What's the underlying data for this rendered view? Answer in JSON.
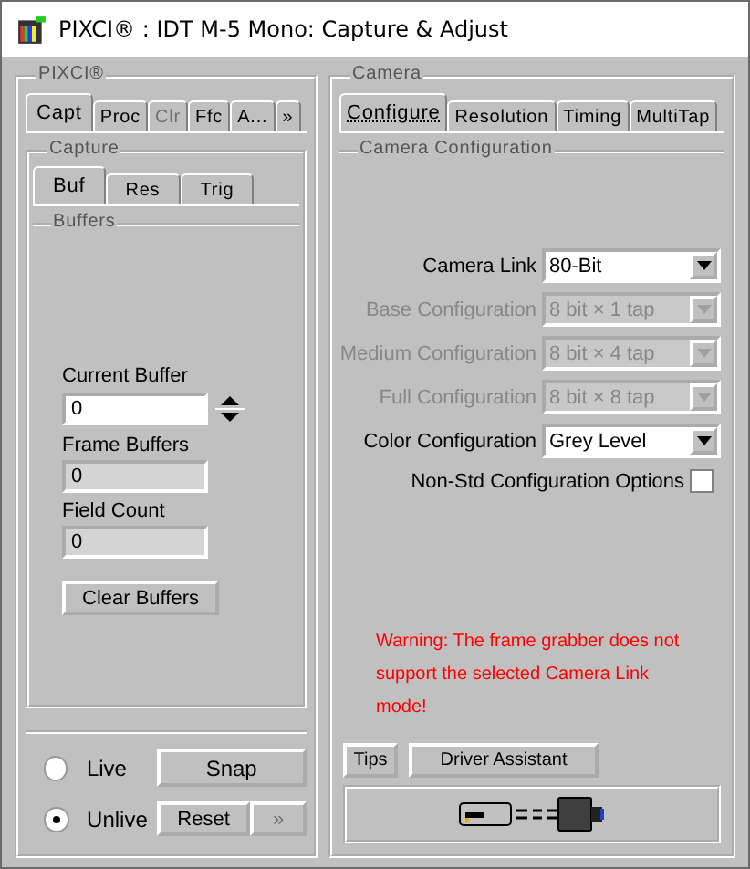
{
  "window": {
    "title": "PIXCI® : IDT M-5 Mono: Capture & Adjust"
  },
  "left": {
    "legend": "PIXCI®",
    "tabs": [
      {
        "label": "Capt",
        "selected": true,
        "disabled": false
      },
      {
        "label": "Proc",
        "selected": false,
        "disabled": false
      },
      {
        "label": "Clr",
        "selected": false,
        "disabled": true
      },
      {
        "label": "Ffc",
        "selected": false,
        "disabled": false
      },
      {
        "label": "A...",
        "selected": false,
        "disabled": false
      },
      {
        "label": "»",
        "selected": false,
        "disabled": false
      }
    ],
    "capture": {
      "legend": "Capture",
      "tabs": [
        {
          "label": "Buf",
          "selected": true
        },
        {
          "label": "Res",
          "selected": false
        },
        {
          "label": "Trig",
          "selected": false
        }
      ],
      "buffers": {
        "legend": "Buffers",
        "fields": [
          {
            "label": "Current Buffer",
            "value": "0",
            "kind": "spin"
          },
          {
            "label": "Frame Buffers",
            "value": "0",
            "kind": "readonly"
          },
          {
            "label": "Field Count",
            "value": "0",
            "kind": "readonly"
          }
        ],
        "clear_button": "Clear Buffers"
      }
    },
    "modes": [
      {
        "label": "Live",
        "selected": false
      },
      {
        "label": "Unlive",
        "selected": true
      }
    ],
    "snap_button": "Snap",
    "reset_button": "Reset",
    "more_button": {
      "label": "»",
      "disabled": true
    }
  },
  "right": {
    "legend": "Camera",
    "tabs": [
      {
        "label": "Configure",
        "selected": true
      },
      {
        "label": "Resolution",
        "selected": false
      },
      {
        "label": "Timing",
        "selected": false
      },
      {
        "label": "MultiTap",
        "selected": false
      }
    ],
    "config": {
      "legend": "Camera Configuration",
      "rows": [
        {
          "label": "Camera Link",
          "value": "80-Bit",
          "disabled": false
        },
        {
          "label": "Base Configuration",
          "value": "8 bit × 1 tap",
          "disabled": true
        },
        {
          "label": "Medium Configuration",
          "value": "8 bit × 4 tap",
          "disabled": true
        },
        {
          "label": "Full Configuration",
          "value": "8 bit × 8 tap",
          "disabled": true
        },
        {
          "label": "Color Configuration",
          "value": "Grey Level",
          "disabled": false
        }
      ],
      "option": {
        "label": "Non-Std Configuration Options",
        "checked": false
      },
      "warning": [
        "Warning: The frame grabber does not",
        "support the selected Camera Link",
        "mode!"
      ]
    },
    "tips_button": "Tips",
    "assistant_button": "Driver Assistant"
  }
}
